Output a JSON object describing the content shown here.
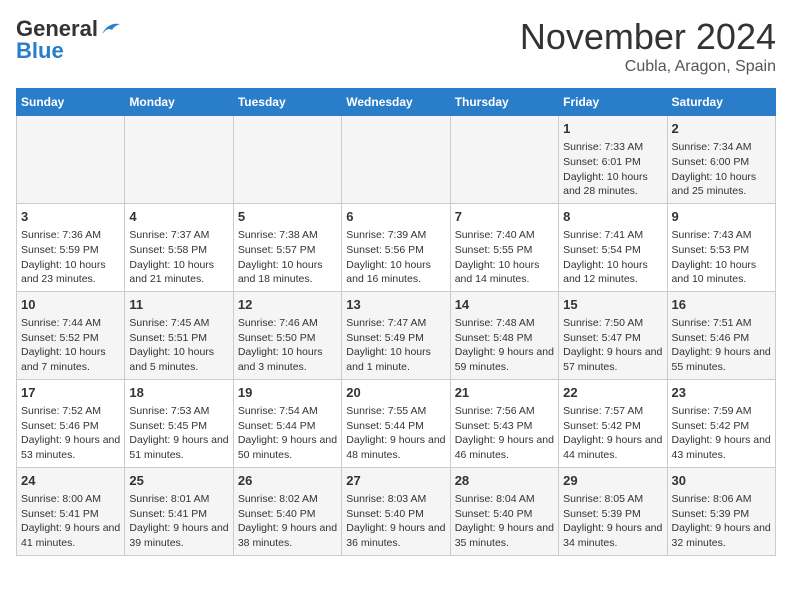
{
  "header": {
    "logo_line1": "General",
    "logo_line2": "Blue",
    "title": "November 2024",
    "subtitle": "Cubla, Aragon, Spain"
  },
  "weekdays": [
    "Sunday",
    "Monday",
    "Tuesday",
    "Wednesday",
    "Thursday",
    "Friday",
    "Saturday"
  ],
  "weeks": [
    [
      {
        "day": "",
        "info": ""
      },
      {
        "day": "",
        "info": ""
      },
      {
        "day": "",
        "info": ""
      },
      {
        "day": "",
        "info": ""
      },
      {
        "day": "",
        "info": ""
      },
      {
        "day": "1",
        "info": "Sunrise: 7:33 AM\nSunset: 6:01 PM\nDaylight: 10 hours and 28 minutes."
      },
      {
        "day": "2",
        "info": "Sunrise: 7:34 AM\nSunset: 6:00 PM\nDaylight: 10 hours and 25 minutes."
      }
    ],
    [
      {
        "day": "3",
        "info": "Sunrise: 7:36 AM\nSunset: 5:59 PM\nDaylight: 10 hours and 23 minutes."
      },
      {
        "day": "4",
        "info": "Sunrise: 7:37 AM\nSunset: 5:58 PM\nDaylight: 10 hours and 21 minutes."
      },
      {
        "day": "5",
        "info": "Sunrise: 7:38 AM\nSunset: 5:57 PM\nDaylight: 10 hours and 18 minutes."
      },
      {
        "day": "6",
        "info": "Sunrise: 7:39 AM\nSunset: 5:56 PM\nDaylight: 10 hours and 16 minutes."
      },
      {
        "day": "7",
        "info": "Sunrise: 7:40 AM\nSunset: 5:55 PM\nDaylight: 10 hours and 14 minutes."
      },
      {
        "day": "8",
        "info": "Sunrise: 7:41 AM\nSunset: 5:54 PM\nDaylight: 10 hours and 12 minutes."
      },
      {
        "day": "9",
        "info": "Sunrise: 7:43 AM\nSunset: 5:53 PM\nDaylight: 10 hours and 10 minutes."
      }
    ],
    [
      {
        "day": "10",
        "info": "Sunrise: 7:44 AM\nSunset: 5:52 PM\nDaylight: 10 hours and 7 minutes."
      },
      {
        "day": "11",
        "info": "Sunrise: 7:45 AM\nSunset: 5:51 PM\nDaylight: 10 hours and 5 minutes."
      },
      {
        "day": "12",
        "info": "Sunrise: 7:46 AM\nSunset: 5:50 PM\nDaylight: 10 hours and 3 minutes."
      },
      {
        "day": "13",
        "info": "Sunrise: 7:47 AM\nSunset: 5:49 PM\nDaylight: 10 hours and 1 minute."
      },
      {
        "day": "14",
        "info": "Sunrise: 7:48 AM\nSunset: 5:48 PM\nDaylight: 9 hours and 59 minutes."
      },
      {
        "day": "15",
        "info": "Sunrise: 7:50 AM\nSunset: 5:47 PM\nDaylight: 9 hours and 57 minutes."
      },
      {
        "day": "16",
        "info": "Sunrise: 7:51 AM\nSunset: 5:46 PM\nDaylight: 9 hours and 55 minutes."
      }
    ],
    [
      {
        "day": "17",
        "info": "Sunrise: 7:52 AM\nSunset: 5:46 PM\nDaylight: 9 hours and 53 minutes."
      },
      {
        "day": "18",
        "info": "Sunrise: 7:53 AM\nSunset: 5:45 PM\nDaylight: 9 hours and 51 minutes."
      },
      {
        "day": "19",
        "info": "Sunrise: 7:54 AM\nSunset: 5:44 PM\nDaylight: 9 hours and 50 minutes."
      },
      {
        "day": "20",
        "info": "Sunrise: 7:55 AM\nSunset: 5:44 PM\nDaylight: 9 hours and 48 minutes."
      },
      {
        "day": "21",
        "info": "Sunrise: 7:56 AM\nSunset: 5:43 PM\nDaylight: 9 hours and 46 minutes."
      },
      {
        "day": "22",
        "info": "Sunrise: 7:57 AM\nSunset: 5:42 PM\nDaylight: 9 hours and 44 minutes."
      },
      {
        "day": "23",
        "info": "Sunrise: 7:59 AM\nSunset: 5:42 PM\nDaylight: 9 hours and 43 minutes."
      }
    ],
    [
      {
        "day": "24",
        "info": "Sunrise: 8:00 AM\nSunset: 5:41 PM\nDaylight: 9 hours and 41 minutes."
      },
      {
        "day": "25",
        "info": "Sunrise: 8:01 AM\nSunset: 5:41 PM\nDaylight: 9 hours and 39 minutes."
      },
      {
        "day": "26",
        "info": "Sunrise: 8:02 AM\nSunset: 5:40 PM\nDaylight: 9 hours and 38 minutes."
      },
      {
        "day": "27",
        "info": "Sunrise: 8:03 AM\nSunset: 5:40 PM\nDaylight: 9 hours and 36 minutes."
      },
      {
        "day": "28",
        "info": "Sunrise: 8:04 AM\nSunset: 5:40 PM\nDaylight: 9 hours and 35 minutes."
      },
      {
        "day": "29",
        "info": "Sunrise: 8:05 AM\nSunset: 5:39 PM\nDaylight: 9 hours and 34 minutes."
      },
      {
        "day": "30",
        "info": "Sunrise: 8:06 AM\nSunset: 5:39 PM\nDaylight: 9 hours and 32 minutes."
      }
    ]
  ]
}
